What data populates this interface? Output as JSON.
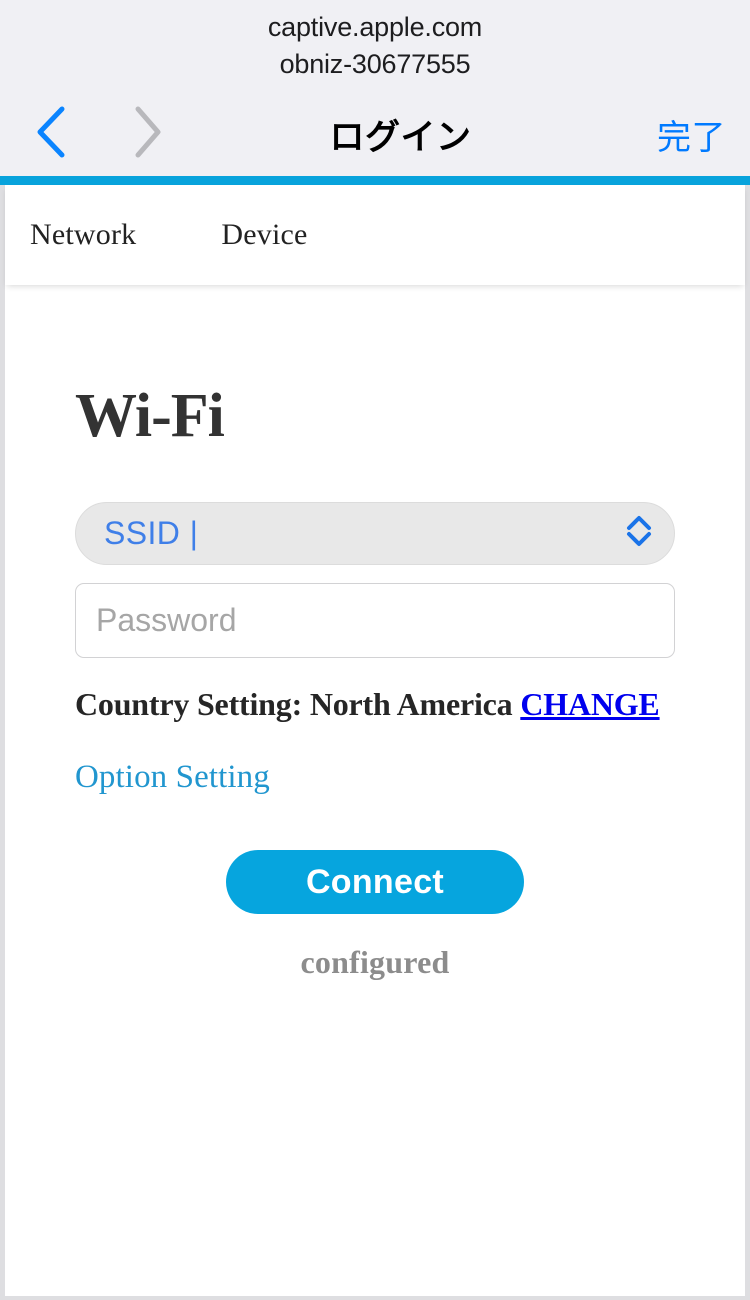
{
  "browser": {
    "url": "captive.apple.com",
    "network_name": "obniz-30677555",
    "toolbar": {
      "title": "ログイン",
      "done_label": "完了",
      "back_icon": "chevron-left-icon",
      "forward_icon": "chevron-right-icon"
    }
  },
  "theme": {
    "accent": "#08a3dc",
    "ios_blue": "#007aff",
    "link_blue": "#0000ee",
    "select_text_blue": "#3f7fe8",
    "connect_button": "#06a5de",
    "status_gray": "#8c8c8c",
    "header_bg": "#f0f0f4"
  },
  "tabs": [
    {
      "label": "Network",
      "active": true
    },
    {
      "label": "Device",
      "active": false
    }
  ],
  "wifi": {
    "heading": "Wi-Fi",
    "ssid": {
      "value": "SSID |",
      "icon": "select-updown-icon"
    },
    "password": {
      "value": "",
      "placeholder": "Password"
    },
    "country": {
      "label": "Country Setting: North America",
      "change_label": "CHANGE"
    },
    "option_setting_label": "Option Setting",
    "connect_label": "Connect",
    "status": "configured"
  }
}
